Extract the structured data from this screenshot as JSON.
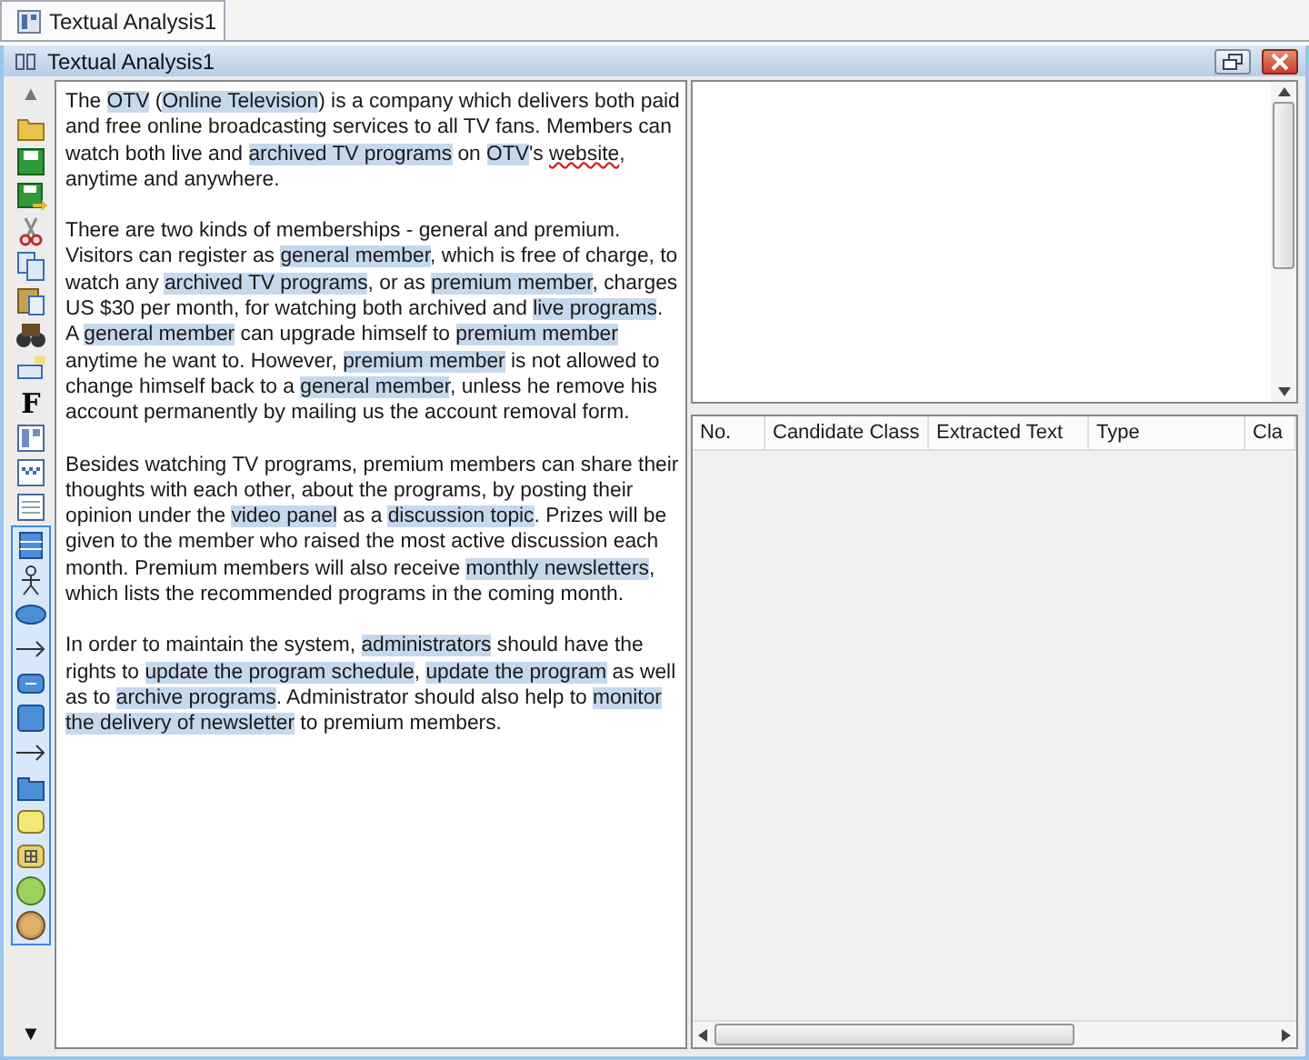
{
  "tabs": [
    {
      "label": "Textual Analysis1",
      "selected": true
    }
  ],
  "frame": {
    "title": "Textual Analysis1"
  },
  "document": {
    "paragraphs": [
      [
        {
          "text": "The ",
          "highlighted": false,
          "misspelled": false
        },
        {
          "text": "OTV",
          "highlighted": true,
          "misspelled": false
        },
        {
          "text": " (",
          "highlighted": false,
          "misspelled": false
        },
        {
          "text": "Online Television",
          "highlighted": true,
          "misspelled": false
        },
        {
          "text": ") is a company which delivers both paid and free online broadcasting services to all TV fans. Members can watch both live and ",
          "highlighted": false,
          "misspelled": false
        },
        {
          "text": "archived TV programs",
          "highlighted": true,
          "misspelled": false
        },
        {
          "text": " on ",
          "highlighted": false,
          "misspelled": false
        },
        {
          "text": "OTV",
          "highlighted": true,
          "misspelled": false
        },
        {
          "text": "'s ",
          "highlighted": false,
          "misspelled": false
        },
        {
          "text": "website",
          "highlighted": false,
          "misspelled": true
        },
        {
          "text": ", anytime and anywhere.",
          "highlighted": false,
          "misspelled": false
        }
      ],
      [
        {
          "text": "There are two kinds of memberships - general and premium. Visitors can register as ",
          "highlighted": false,
          "misspelled": false
        },
        {
          "text": "general member",
          "highlighted": true,
          "misspelled": false
        },
        {
          "text": ", which is free of charge, to watch any ",
          "highlighted": false,
          "misspelled": false
        },
        {
          "text": "archived TV programs",
          "highlighted": true,
          "misspelled": false
        },
        {
          "text": ", or as ",
          "highlighted": false,
          "misspelled": false
        },
        {
          "text": "premium member",
          "highlighted": true,
          "misspelled": false
        },
        {
          "text": ", charges US $30 per month, for watching both archived and ",
          "highlighted": false,
          "misspelled": false
        },
        {
          "text": "live programs",
          "highlighted": true,
          "misspelled": false
        },
        {
          "text": ". A ",
          "highlighted": false,
          "misspelled": false
        },
        {
          "text": "general member",
          "highlighted": true,
          "misspelled": false
        },
        {
          "text": " can upgrade himself to ",
          "highlighted": false,
          "misspelled": false
        },
        {
          "text": "premium member",
          "highlighted": true,
          "misspelled": false
        },
        {
          "text": " anytime he want to. However, ",
          "highlighted": false,
          "misspelled": false
        },
        {
          "text": "premium member",
          "highlighted": true,
          "misspelled": false
        },
        {
          "text": " is not allowed to change himself back to a ",
          "highlighted": false,
          "misspelled": false
        },
        {
          "text": "general member",
          "highlighted": true,
          "misspelled": false
        },
        {
          "text": ", unless he remove his account permanently by mailing us the account removal form.",
          "highlighted": false,
          "misspelled": false
        }
      ],
      [
        {
          "text": "Besides watching TV programs, premium members can share their thoughts with each other, about the programs, by posting their opinion under the ",
          "highlighted": false,
          "misspelled": false
        },
        {
          "text": "video panel",
          "highlighted": true,
          "misspelled": false
        },
        {
          "text": " as a ",
          "highlighted": false,
          "misspelled": false
        },
        {
          "text": "discussion topic",
          "highlighted": true,
          "misspelled": false
        },
        {
          "text": ". Prizes will be given to the member who raised the most active discussion each month. Premium members will also receive ",
          "highlighted": false,
          "misspelled": false
        },
        {
          "text": "monthly newsletters",
          "highlighted": true,
          "misspelled": false
        },
        {
          "text": ", which lists the recommended programs in the coming month.",
          "highlighted": false,
          "misspelled": false
        }
      ],
      [
        {
          "text": "In order to maintain the system, ",
          "highlighted": false,
          "misspelled": false
        },
        {
          "text": "administrators",
          "highlighted": true,
          "misspelled": false
        },
        {
          "text": " should have the rights to ",
          "highlighted": false,
          "misspelled": false
        },
        {
          "text": "update the program schedule",
          "highlighted": true,
          "misspelled": false
        },
        {
          "text": ", ",
          "highlighted": false,
          "misspelled": false
        },
        {
          "text": "update the program",
          "highlighted": true,
          "misspelled": false
        },
        {
          "text": " as well as to ",
          "highlighted": false,
          "misspelled": false
        },
        {
          "text": "archive programs",
          "highlighted": true,
          "misspelled": false
        },
        {
          "text": ". Administrator should also help to ",
          "highlighted": false,
          "misspelled": false
        },
        {
          "text": "monitor the delivery of newsletter",
          "highlighted": true,
          "misspelled": false
        },
        {
          "text": " to premium members.",
          "highlighted": false,
          "misspelled": false
        }
      ]
    ]
  },
  "table": {
    "columns": [
      "No.",
      "Candidate Class",
      "Extracted Text",
      "Type",
      "Cla"
    ]
  },
  "toolbar_top_scroll": "▲",
  "toolbar_bottom_scroll": "▼",
  "letter_tool": "F"
}
